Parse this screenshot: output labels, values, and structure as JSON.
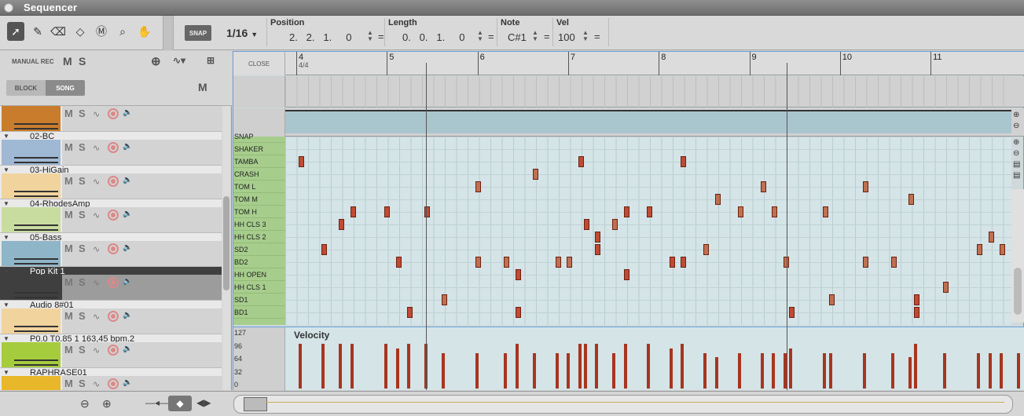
{
  "window": {
    "title": "Sequencer"
  },
  "toolbar": {
    "tools": [
      "pointer-tool",
      "pencil-tool",
      "eraser-tool",
      "razor-tool",
      "mute-tool",
      "magnify-tool",
      "hand-tool"
    ],
    "snap_label": "SNAP",
    "snap_value": "1/16",
    "position_label": "Position",
    "position_value": "2.   2.   1.     0",
    "length_label": "Length",
    "length_value": "0.   0.   1.     0",
    "note_label": "Note",
    "note_value": "C#1",
    "vel_label": "Vel",
    "vel_value": "100",
    "eq": "="
  },
  "left": {
    "manual_rec": "MANUAL REC",
    "m": "M",
    "s": "S",
    "block": "BLOCK",
    "song": "SONG",
    "tracks": [
      {
        "name": "",
        "color": "#c97d2c"
      },
      {
        "name": "02-BC",
        "color": "#9fb8d4"
      },
      {
        "name": "03-HiGain",
        "color": "#f1d39e"
      },
      {
        "name": "04-RhodesAmp",
        "color": "#c8dca0"
      },
      {
        "name": "05-Bass",
        "color": "#8fb5c8"
      },
      {
        "name": "Pop Kit 1",
        "color": "#3f3f3f",
        "selected": true
      },
      {
        "name": "Audio 8#01",
        "color": "#f1d39e"
      },
      {
        "name": "P0.0 T0.85 1 163,45 bpm.2",
        "color": "#a5cc3d"
      },
      {
        "name": "RAPHRASE01",
        "color": "#e8b72a"
      }
    ]
  },
  "main": {
    "close": "CLOSE",
    "timesig": "4/4",
    "bars": [
      "4",
      "5",
      "6",
      "7",
      "8",
      "9",
      "10",
      "11"
    ],
    "velocity_title": "Velocity",
    "vel_scale": [
      "127",
      "96",
      "64",
      "32",
      "0"
    ],
    "drums": [
      "SNAP",
      "SHAKER",
      "TAMBA",
      "CRASH",
      "TOM L",
      "TOM M",
      "TOM H",
      "HH CLS 3",
      "HH CLS 2",
      "SD2",
      "BD2",
      "HH OPEN",
      "HH CLS 1",
      "SD1",
      "BD1"
    ]
  },
  "notes": [
    {
      "r": 2,
      "x": 0.5,
      "v": 100
    },
    {
      "r": 2,
      "x": 25,
      "v": 100
    },
    {
      "r": 2,
      "x": 34,
      "v": 100
    },
    {
      "r": 3,
      "x": 21,
      "v": 80
    },
    {
      "r": 4,
      "x": 16,
      "v": 80
    },
    {
      "r": 4,
      "x": 41,
      "v": 80
    },
    {
      "r": 4,
      "x": 50,
      "v": 80
    },
    {
      "r": 5,
      "x": 37,
      "v": 70
    },
    {
      "r": 5,
      "x": 54,
      "v": 70
    },
    {
      "r": 6,
      "x": 5,
      "v": 100
    },
    {
      "r": 6,
      "x": 8,
      "v": 100
    },
    {
      "r": 6,
      "x": 11.5,
      "v": 100
    },
    {
      "r": 6,
      "x": 29,
      "v": 100
    },
    {
      "r": 6,
      "x": 31,
      "v": 100
    },
    {
      "r": 6,
      "x": 39,
      "v": 80
    },
    {
      "r": 6,
      "x": 42,
      "v": 80
    },
    {
      "r": 6,
      "x": 46.5,
      "v": 80
    },
    {
      "r": 7,
      "x": 4,
      "v": 100
    },
    {
      "r": 7,
      "x": 25.5,
      "v": 100
    },
    {
      "r": 7,
      "x": 28,
      "v": 80
    },
    {
      "r": 8,
      "x": 26.5,
      "v": 100
    },
    {
      "r": 8,
      "x": 61,
      "v": 80
    },
    {
      "r": 9,
      "x": 2.5,
      "v": 100
    },
    {
      "r": 9,
      "x": 26.5,
      "v": 100
    },
    {
      "r": 9,
      "x": 36,
      "v": 80
    },
    {
      "r": 9,
      "x": 60,
      "v": 80
    },
    {
      "r": 9,
      "x": 62,
      "v": 80
    },
    {
      "r": 10,
      "x": 9,
      "v": 90
    },
    {
      "r": 10,
      "x": 16,
      "v": 80
    },
    {
      "r": 10,
      "x": 18.5,
      "v": 80
    },
    {
      "r": 10,
      "x": 23,
      "v": 80
    },
    {
      "r": 10,
      "x": 24,
      "v": 80
    },
    {
      "r": 10,
      "x": 33,
      "v": 90
    },
    {
      "r": 10,
      "x": 34,
      "v": 90
    },
    {
      "r": 10,
      "x": 43,
      "v": 80
    },
    {
      "r": 10,
      "x": 50,
      "v": 80
    },
    {
      "r": 10,
      "x": 52.5,
      "v": 80
    },
    {
      "r": 11,
      "x": 19.5,
      "v": 100
    },
    {
      "r": 11,
      "x": 29,
      "v": 100
    },
    {
      "r": 12,
      "x": 57,
      "v": 80
    },
    {
      "r": 13,
      "x": 13,
      "v": 80
    },
    {
      "r": 13,
      "x": 47,
      "v": 80
    },
    {
      "r": 13,
      "x": 54.5,
      "v": 100
    },
    {
      "r": 13,
      "x": 63.5,
      "v": 80
    },
    {
      "r": 14,
      "x": 10,
      "v": 100
    },
    {
      "r": 14,
      "x": 19.5,
      "v": 100
    },
    {
      "r": 14,
      "x": 43.5,
      "v": 90
    },
    {
      "r": 14,
      "x": 54.5,
      "v": 100
    }
  ],
  "colors": {
    "accent": "#6aa0d8",
    "note": "#c04a33",
    "drumLabel": "#a6cd8c"
  }
}
